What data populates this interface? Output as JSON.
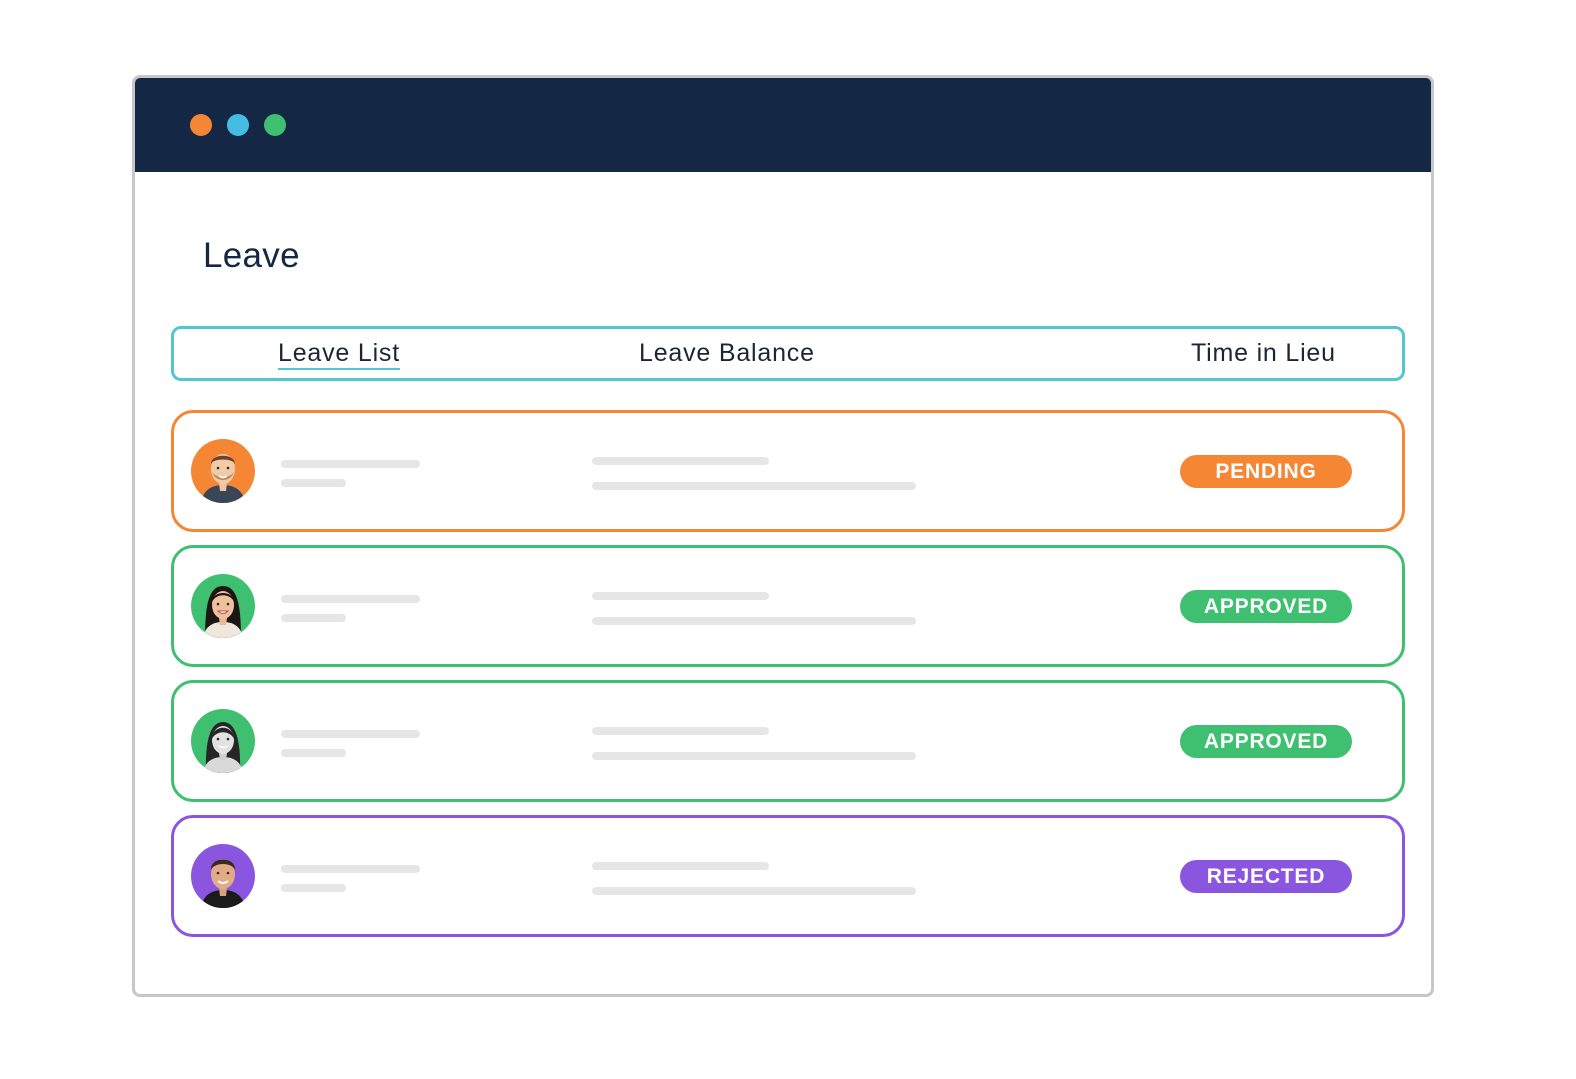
{
  "window": {
    "title_dots": [
      {
        "name": "close-dot",
        "color": "#f58634"
      },
      {
        "name": "minimize-dot",
        "color": "#45bde3"
      },
      {
        "name": "maximize-dot",
        "color": "#3ec070"
      }
    ]
  },
  "page": {
    "title": "Leave"
  },
  "tabs": [
    {
      "label": "Leave List",
      "active": true
    },
    {
      "label": "Leave Balance",
      "active": false
    },
    {
      "label": "Time in Lieu",
      "active": false
    }
  ],
  "colors": {
    "navy": "#142745",
    "teal": "#54c5d3",
    "orange": "#f58634",
    "green": "#3ec070",
    "purple": "#8a56df",
    "skeleton": "#e6e6e6"
  },
  "leave_requests": [
    {
      "status": "PENDING",
      "status_color": "#f58634",
      "avatar": "man-avatar"
    },
    {
      "status": "APPROVED",
      "status_color": "#3ec070",
      "avatar": "woman-avatar"
    },
    {
      "status": "APPROVED",
      "status_color": "#3ec070",
      "avatar": "woman-avatar"
    },
    {
      "status": "REJECTED",
      "status_color": "#8a56df",
      "avatar": "man-avatar"
    }
  ]
}
